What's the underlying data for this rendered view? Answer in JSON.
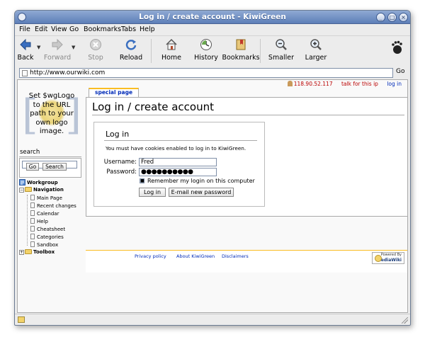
{
  "window": {
    "title": "Log in / create account - KiwiGreen"
  },
  "menu": [
    "File",
    "Edit",
    "View",
    "Go",
    "Bookmarks",
    "Tabs",
    "Help"
  ],
  "toolbar": {
    "back": "Back",
    "forward": "Forward",
    "stop": "Stop",
    "reload": "Reload",
    "home": "Home",
    "history": "History",
    "bookmarks": "Bookmarks",
    "smaller": "Smaller",
    "larger": "Larger"
  },
  "location": {
    "url": "http://www.ourwiki.com",
    "go": "Go"
  },
  "personal": {
    "ip": "118.90.52.117",
    "talk": "talk for this ip",
    "login": "log in"
  },
  "logo": {
    "text": "Set $wgLogo to the URL path to your own logo image."
  },
  "search": {
    "heading": "search",
    "query": "",
    "go_button": "Go",
    "search_button": "Search"
  },
  "tree": {
    "workgroup": "Workgroup",
    "navigation": "Navigation",
    "items": [
      "Main Page",
      "Recent changes",
      "Calendar",
      "Help",
      "Cheatsheet",
      "Categories",
      "Sandbox"
    ],
    "toolbox": "Toolbox"
  },
  "tab": {
    "label": "special page"
  },
  "content": {
    "heading": "Log in / create account",
    "login_heading": "Log in",
    "cookie_notice": "You must have cookies enabled to log in to KiwiGreen.",
    "username_label": "Username:",
    "username_value": "Fred",
    "password_label": "Password:",
    "password_value": "●●●●●●●●●●",
    "remember_label": "Remember my login on this computer",
    "remember_checked": true,
    "login_button": "Log in",
    "email_button": "E-mail new password"
  },
  "footer": {
    "privacy": "Privacy policy",
    "about": "About KiwiGreen",
    "disclaimers": "Disclaimers",
    "powered_line1": "Powered By",
    "powered_line2": "MediaWiki"
  }
}
